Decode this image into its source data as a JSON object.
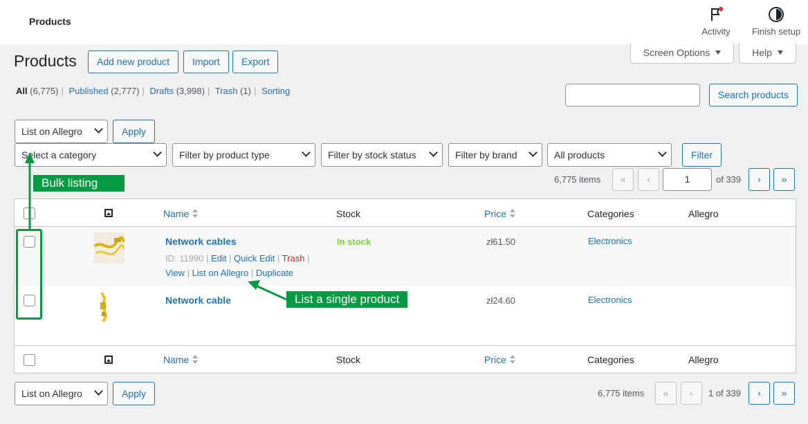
{
  "topbar": {
    "breadcrumb": "Products",
    "activity_label": "Activity",
    "finish_setup_label": "Finish setup"
  },
  "screen_options": {
    "screen_options_label": "Screen Options",
    "help_label": "Help"
  },
  "header": {
    "title": "Products",
    "add_new_label": "Add new product",
    "import_label": "Import",
    "export_label": "Export"
  },
  "views": [
    {
      "label": "All",
      "count": "(6,775)"
    },
    {
      "label": "Published",
      "count": "(2,777)"
    },
    {
      "label": "Drafts",
      "count": "(3,998)"
    },
    {
      "label": "Trash",
      "count": "(1)"
    },
    {
      "label": "Sorting",
      "count": ""
    }
  ],
  "search": {
    "value": "",
    "button_label": "Search products"
  },
  "bulk_top": {
    "selected": "List on Allegro",
    "apply_label": "Apply"
  },
  "filters": {
    "category": "Select a category",
    "product_type": "Filter by product type",
    "stock_status": "Filter by stock status",
    "brand": "Filter by brand",
    "all_products": "All products",
    "filter_button": "Filter"
  },
  "pagination_top": {
    "items": "6,775 items",
    "first": "«",
    "prev": "‹",
    "current_page": "1",
    "of_total": "of 339",
    "next": "›",
    "last": "»"
  },
  "table": {
    "columns": {
      "name": "Name",
      "stock": "Stock",
      "price": "Price",
      "categories": "Categories",
      "allegro": "Allegro"
    },
    "rows": [
      {
        "name": "Network cables",
        "id_text": "ID: 11990",
        "actions": {
          "edit": "Edit",
          "quick_edit": "Quick Edit",
          "trash": "Trash",
          "view": "View",
          "list_on_allegro": "List on Allegro",
          "duplicate": "Duplicate"
        },
        "stock": "In stock",
        "price": "zł61.50",
        "category": "Electronics"
      },
      {
        "name": "Network cable",
        "stock": "",
        "price": "zł24.60",
        "category": "Electronics"
      }
    ]
  },
  "bulk_bottom": {
    "selected": "List on Allegro",
    "apply_label": "Apply"
  },
  "pagination_bottom": {
    "items": "6,775 items",
    "first": "«",
    "prev": "‹",
    "page_text": "1 of 339",
    "next": "›",
    "last": "»"
  },
  "annotations": {
    "bulk_listing": "Bulk listing",
    "single_product": "List a single product"
  },
  "colors": {
    "accent": "#2271b1",
    "annotation_green": "#069a42",
    "in_stock": "#7ad03a",
    "trash": "#b32d2e"
  }
}
